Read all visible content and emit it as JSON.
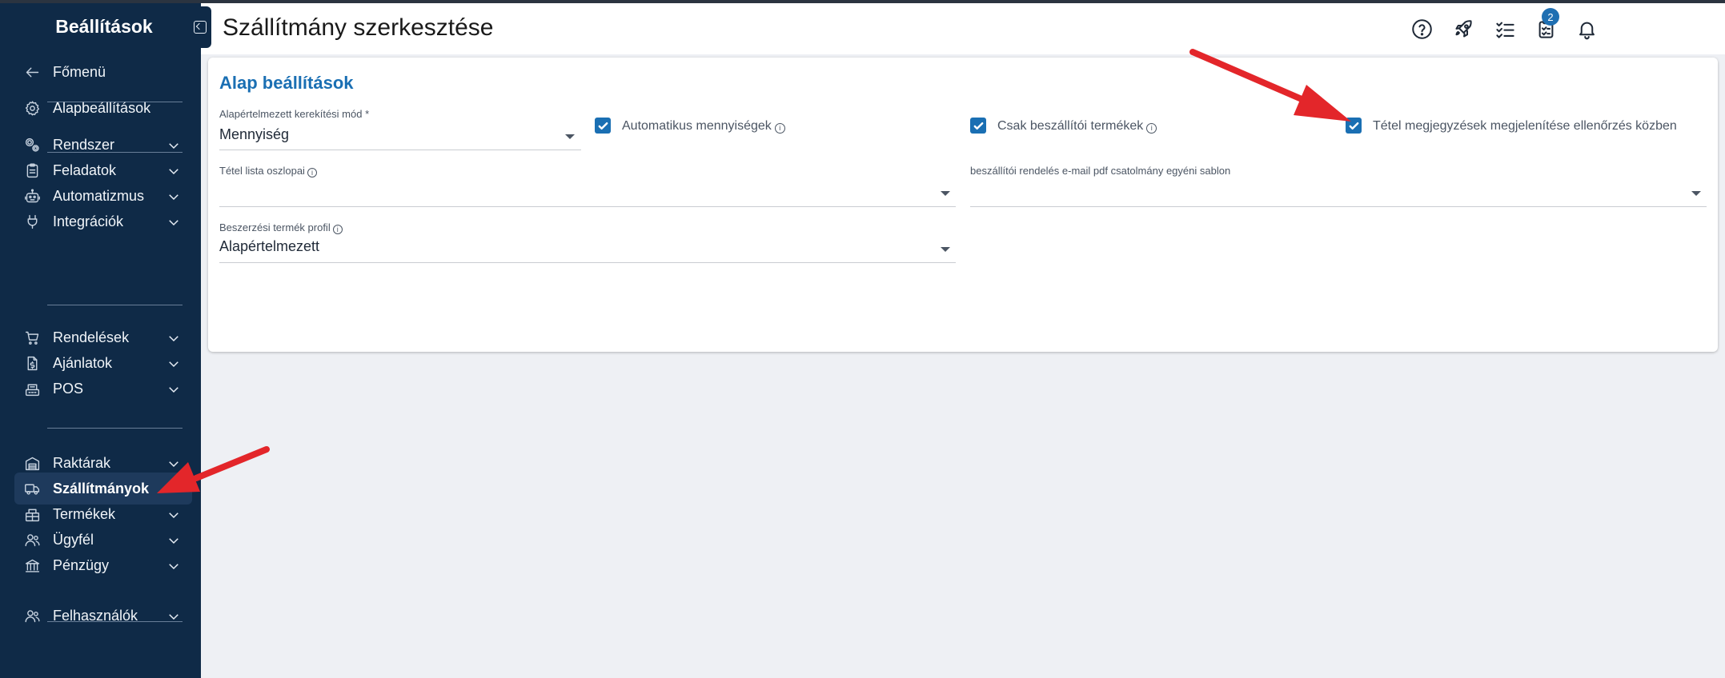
{
  "sidebar": {
    "title": "Beállítások",
    "collapse_icon": "collapse-left-icon",
    "items": [
      {
        "label": "Főmenü",
        "icon": "arrow-left-icon"
      },
      {
        "label": "Alapbeállítások",
        "icon": "gear-icon"
      },
      {
        "label": "Rendszer",
        "icon": "cogs-icon"
      },
      {
        "label": "Feladatok",
        "icon": "clipboard-icon"
      },
      {
        "label": "Automatizmus",
        "icon": "robot-icon"
      },
      {
        "label": "Integrációk",
        "icon": "plug-icon"
      },
      {
        "label": "Rendelések",
        "icon": "cart-icon"
      },
      {
        "label": "Ajánlatok",
        "icon": "document-dollar-icon"
      },
      {
        "label": "POS",
        "icon": "register-icon"
      },
      {
        "label": "Raktárak",
        "icon": "warehouse-icon"
      },
      {
        "label": "Szállítmányok",
        "icon": "truck-icon",
        "active": true
      },
      {
        "label": "Termékek",
        "icon": "box-icon"
      },
      {
        "label": "Ügyfél",
        "icon": "users-icon"
      },
      {
        "label": "Pénzügy",
        "icon": "bank-icon"
      },
      {
        "label": "Felhasználók",
        "icon": "users-icon"
      }
    ]
  },
  "header": {
    "title": "Szállítmány szerkesztése",
    "icons": [
      "help-icon",
      "rocket-icon",
      "checklist-icon",
      "clipboard-check-icon",
      "bell-icon"
    ],
    "badge": "2"
  },
  "card": {
    "title": "Alap beállítások",
    "rounding_label": "Alapértelmezett kerekítési mód *",
    "rounding_value": "Mennyiség",
    "auto_qty_label": "Automatikus mennyiségek",
    "supplier_only_label": "Csak beszállítói termékek",
    "item_notes_label": "Tétel megjegyzések megjelenítése ellenőrzés közben",
    "columns_label": "Tétel lista oszlopai",
    "email_template_label": "beszállítói rendelés e-mail pdf csatolmány egyéni sablon",
    "profile_label": "Beszerzési termék profil",
    "profile_value": "Alapértelmezett",
    "info_glyph": "i"
  },
  "colors": {
    "sidebar_bg": "#0f2a47",
    "accent": "#1a6fb3",
    "arrow": "#e3262a",
    "page_bg": "#eef0f4"
  }
}
